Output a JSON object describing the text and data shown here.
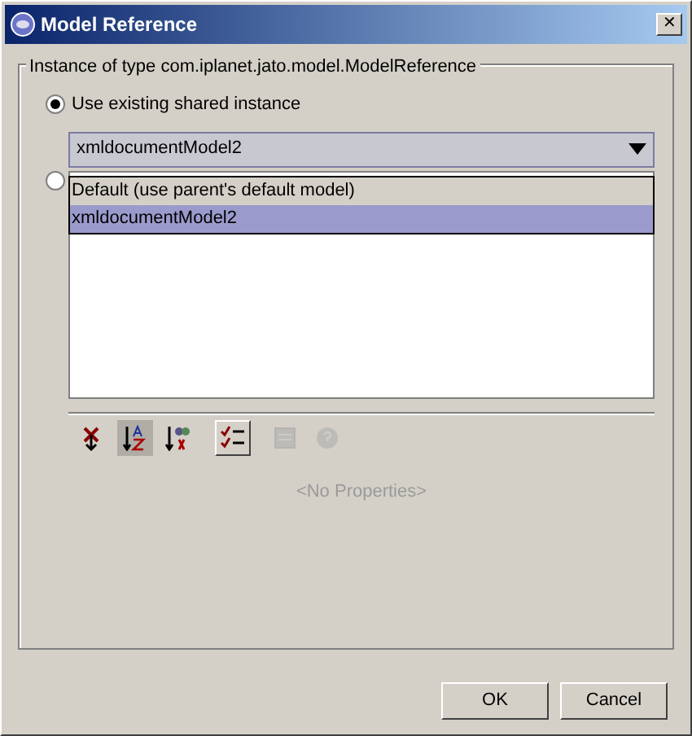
{
  "window": {
    "title": "Model Reference",
    "close": "✕"
  },
  "group": {
    "title": "Instance of type com.iplanet.jato.model.ModelReference"
  },
  "options": [
    {
      "label": "Use existing shared instance",
      "selected": true
    },
    {
      "selected": false
    }
  ],
  "combo": {
    "value": "xmldocumentModel2",
    "expanded": true,
    "items": [
      {
        "label": "Default (use parent's default model)",
        "selected": false
      },
      {
        "label": "xmldocumentModel2",
        "selected": true
      }
    ]
  },
  "toolbar": [
    {
      "kind": "unsorted",
      "pressed": false,
      "disabled": false
    },
    {
      "kind": "sort-name",
      "pressed": true,
      "disabled": false
    },
    {
      "kind": "sort-type",
      "pressed": false,
      "disabled": false
    },
    {
      "kind": "checklist",
      "pressed": false,
      "raised": true,
      "disabled": false
    },
    {
      "kind": "sheet",
      "pressed": false,
      "disabled": true
    },
    {
      "kind": "help",
      "pressed": false,
      "disabled": true
    }
  ],
  "properties": {
    "empty_text": "<No Properties>"
  },
  "buttons": [
    "OK",
    "Cancel"
  ]
}
